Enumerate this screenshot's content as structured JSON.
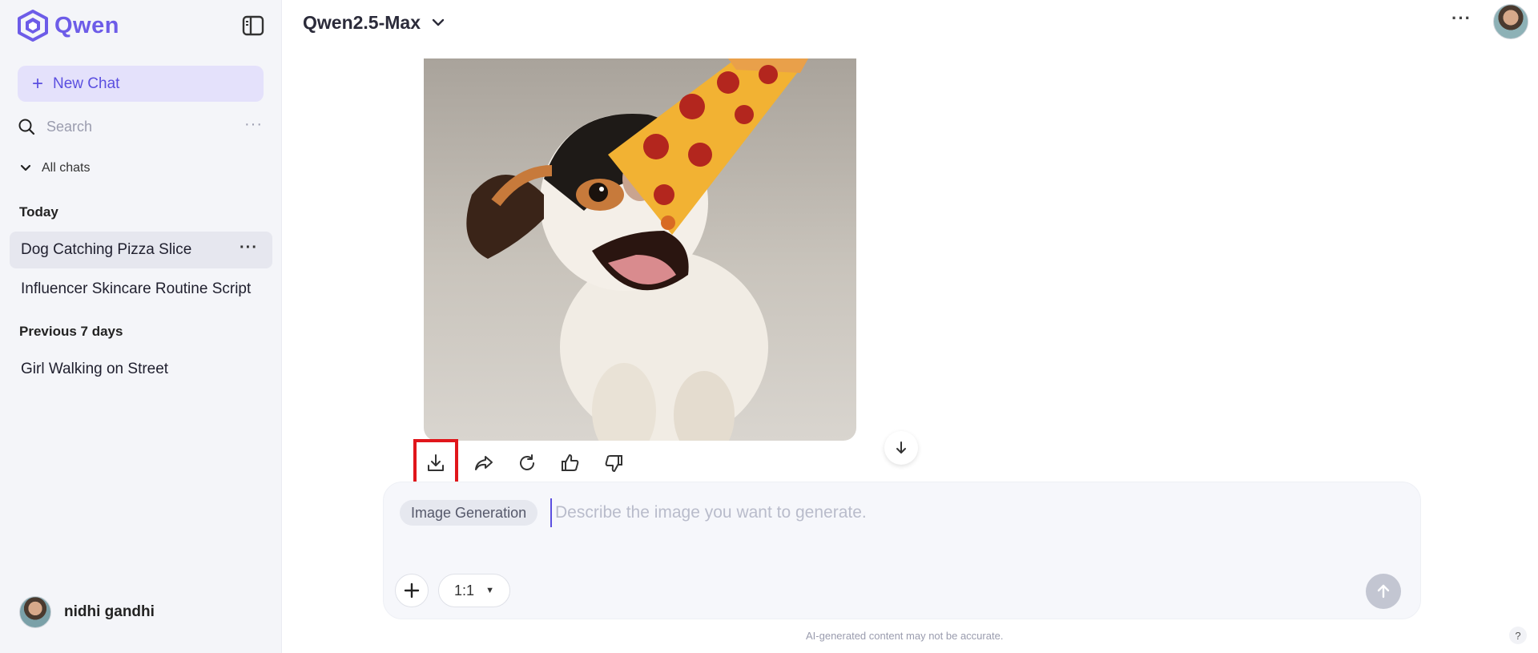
{
  "app": {
    "logo_text": "Qwen",
    "brand_color": "#6d5ce8"
  },
  "sidebar": {
    "new_chat_label": "New Chat",
    "search_placeholder": "Search",
    "all_chats_label": "All chats",
    "groups": [
      {
        "label": "Today",
        "items": [
          {
            "label": "Dog Catching Pizza Slice",
            "active": true
          },
          {
            "label": "Influencer Skincare Routine Script",
            "active": false
          }
        ]
      },
      {
        "label": "Previous 7 days",
        "items": [
          {
            "label": "Girl Walking on Street",
            "active": false
          }
        ]
      }
    ],
    "user": {
      "name": "nidhi gandhi"
    }
  },
  "header": {
    "model_name": "Qwen2.5-Max"
  },
  "message": {
    "image_icon": "dog-catching-pizza-image",
    "actions": [
      "download-icon",
      "share-icon",
      "regenerate-icon",
      "thumbs-up-icon",
      "thumbs-down-icon"
    ]
  },
  "composer": {
    "mode_chip": "Image Generation",
    "placeholder": "Describe the image you want to generate.",
    "aspect_ratio": "1:1"
  },
  "footer": {
    "disclaimer": "AI-generated content may not be accurate.",
    "help": "?"
  },
  "colors": {
    "highlight": "#e0161b",
    "accent": "#5b4fe0",
    "sidebar_bg": "#f4f5f9"
  }
}
